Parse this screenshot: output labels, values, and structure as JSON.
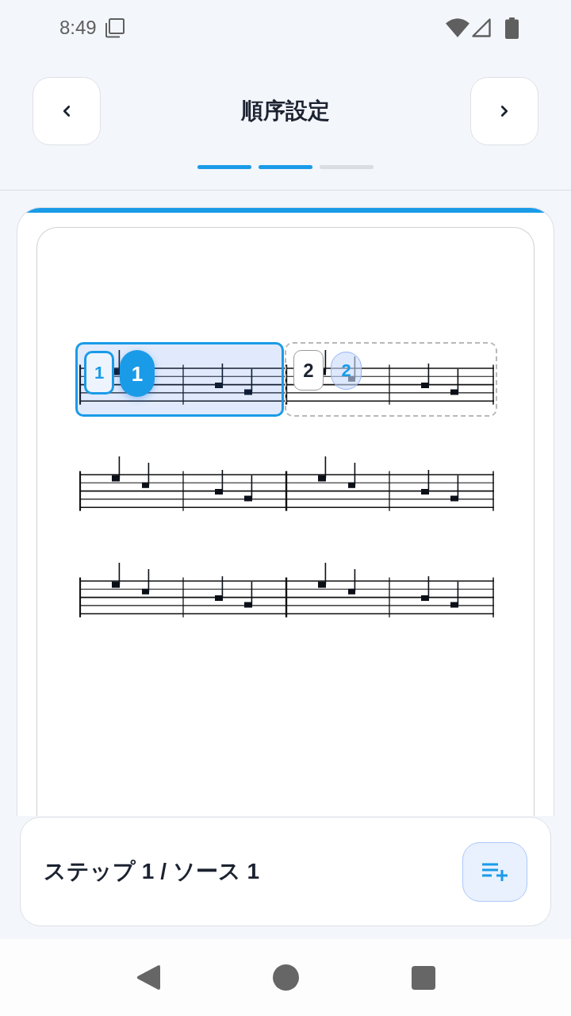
{
  "status_bar": {
    "time": "8:49"
  },
  "header": {
    "title": "順序設定",
    "progress": [
      {
        "done": true
      },
      {
        "done": true
      },
      {
        "done": false
      }
    ]
  },
  "score": {
    "segments": [
      {
        "selected": true,
        "markers": [
          {
            "kind": "outline",
            "text": "1"
          },
          {
            "kind": "filled",
            "text": "1"
          }
        ]
      },
      {
        "selected": false,
        "markers": [
          {
            "kind": "plain",
            "text": "2"
          },
          {
            "kind": "ghost",
            "text": "2"
          }
        ]
      }
    ]
  },
  "footer": {
    "label": "ステップ 1 / ソース 1"
  }
}
